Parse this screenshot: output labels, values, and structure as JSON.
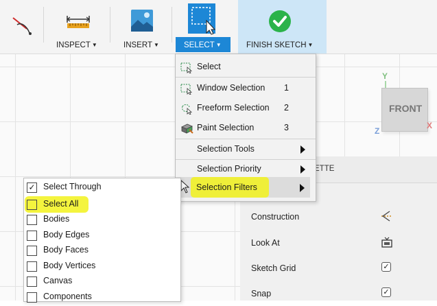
{
  "toolbar": {
    "inspect_label": "INSPECT",
    "insert_label": "INSERT",
    "select_label": "SELECT",
    "finish_label": "FINISH SKETCH",
    "caret": "▼"
  },
  "select_menu": {
    "items": [
      {
        "label": "Select",
        "shortcut": "",
        "icon": "select-box-icon"
      },
      {
        "label": "Window Selection",
        "shortcut": "1",
        "icon": "window-selection-icon"
      },
      {
        "label": "Freeform Selection",
        "shortcut": "2",
        "icon": "freeform-selection-icon"
      },
      {
        "label": "Paint Selection",
        "shortcut": "3",
        "icon": "paint-selection-icon"
      },
      {
        "label": "Selection Tools",
        "shortcut": "",
        "icon": ""
      },
      {
        "label": "Selection Priority",
        "shortcut": "",
        "icon": ""
      },
      {
        "label": "Selection Filters",
        "shortcut": "",
        "icon": ""
      }
    ]
  },
  "filters": {
    "items": [
      {
        "label": "Select Through",
        "checked": true
      },
      {
        "label": "Select All",
        "checked": false
      },
      {
        "label": "Bodies",
        "checked": false
      },
      {
        "label": "Body Edges",
        "checked": false
      },
      {
        "label": "Body Faces",
        "checked": false
      },
      {
        "label": "Body Vertices",
        "checked": false
      },
      {
        "label": "Canvas",
        "checked": false
      },
      {
        "label": "Components",
        "checked": false
      }
    ]
  },
  "palette": {
    "title_fragment": "ETTE",
    "rows": [
      {
        "label": "Construction",
        "control": "construction-icon"
      },
      {
        "label": "Look At",
        "control": "look-at-icon"
      },
      {
        "label": "Sketch Grid",
        "control": "checkbox",
        "checked": true
      },
      {
        "label": "Snap",
        "control": "checkbox",
        "checked": true
      }
    ]
  },
  "viewcube": {
    "face": "FRONT",
    "axis_y": "Y",
    "axis_z": "Z",
    "axis_x": "X"
  },
  "colors": {
    "accent_blue": "#1d87d6",
    "highlight_yellow": "#f2f21c",
    "finish_green": "#2bb34a"
  }
}
